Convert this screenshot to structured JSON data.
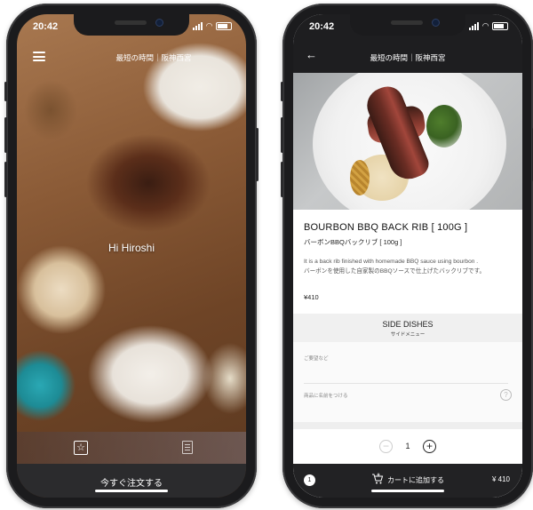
{
  "status": {
    "time": "20:42"
  },
  "left": {
    "header_title": "最短の時間｜阪神西宮",
    "greeting": "Hi Hiroshi",
    "tabbar": {
      "favorites_icon": "star-icon",
      "orders_icon": "receipt-icon"
    },
    "order_button": "今すぐ注文する"
  },
  "right": {
    "header_title": "最短の時間｜阪神西宮",
    "product": {
      "name": "BOURBON BBQ BACK RIB [ 100G ]",
      "name_ja": "バーボンBBQバックリブ [ 100g ]",
      "description_en": "It is a back rib finished with homemade BBQ sauce using bourbon .",
      "description_ja": "バーボンを使用した自家製のBBQソースで仕上げたバックリブです。",
      "price": "¥410"
    },
    "side_dishes": {
      "title": "SIDE DISHES",
      "subtitle": "サイドメニュー"
    },
    "form": {
      "request_label": "ご要望など",
      "name_label": "商品に名前をつける"
    },
    "quantity": "1",
    "cart": {
      "count": "1",
      "label": "カートに追加する",
      "total": "¥ 410"
    }
  }
}
